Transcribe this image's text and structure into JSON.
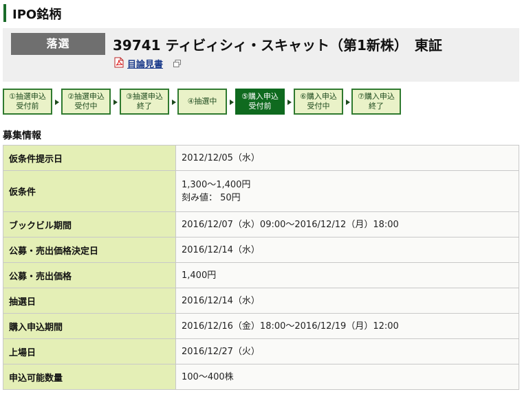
{
  "header": {
    "title": "IPO銘柄"
  },
  "stock": {
    "status_badge": "落選",
    "title": "39741 ティビィシィ・スキャット（第1新株）　東証",
    "prospectus_link": "目論見書",
    "icons": [
      "pdf-icon",
      "external-window-icon"
    ]
  },
  "steps": [
    {
      "lines": [
        "①抽選申込",
        "受付前"
      ],
      "active": false
    },
    {
      "lines": [
        "②抽選申込",
        "受付中"
      ],
      "active": false
    },
    {
      "lines": [
        "③抽選申込",
        "終了"
      ],
      "active": false
    },
    {
      "lines": [
        "④抽選中"
      ],
      "active": false
    },
    {
      "lines": [
        "⑤購入申込",
        "受付前"
      ],
      "active": true
    },
    {
      "lines": [
        "⑥購入申込",
        "受付中"
      ],
      "active": false
    },
    {
      "lines": [
        "⑦購入申込",
        "終了"
      ],
      "active": false
    }
  ],
  "section": {
    "title": "募集情報"
  },
  "info_rows": [
    {
      "label": "仮条件提示日",
      "values": [
        "2012/12/05（水）"
      ]
    },
    {
      "label": "仮条件",
      "values": [
        "1,300～1,400円",
        "刻み値： 50円"
      ]
    },
    {
      "label": "ブックビル期間",
      "values": [
        "2016/12/07（水）09:00～2016/12/12（月）18:00"
      ]
    },
    {
      "label": "公募・売出価格決定日",
      "values": [
        "2016/12/14（水）"
      ]
    },
    {
      "label": "公募・売出価格",
      "values": [
        "1,400円"
      ]
    },
    {
      "label": "抽選日",
      "values": [
        "2016/12/14（水）"
      ]
    },
    {
      "label": "購入申込期間",
      "values": [
        "2016/12/16（金）18:00～2016/12/19（月）12:00"
      ]
    },
    {
      "label": "上場日",
      "values": [
        "2016/12/27（火）"
      ]
    },
    {
      "label": "申込可能数量",
      "values": [
        "100～400株"
      ]
    }
  ],
  "colors": {
    "accent_green": "#1a6b2a",
    "active_step": "#0f6a1f",
    "label_bg": "#e4efb6",
    "badge_gray": "#6f6f6f"
  }
}
